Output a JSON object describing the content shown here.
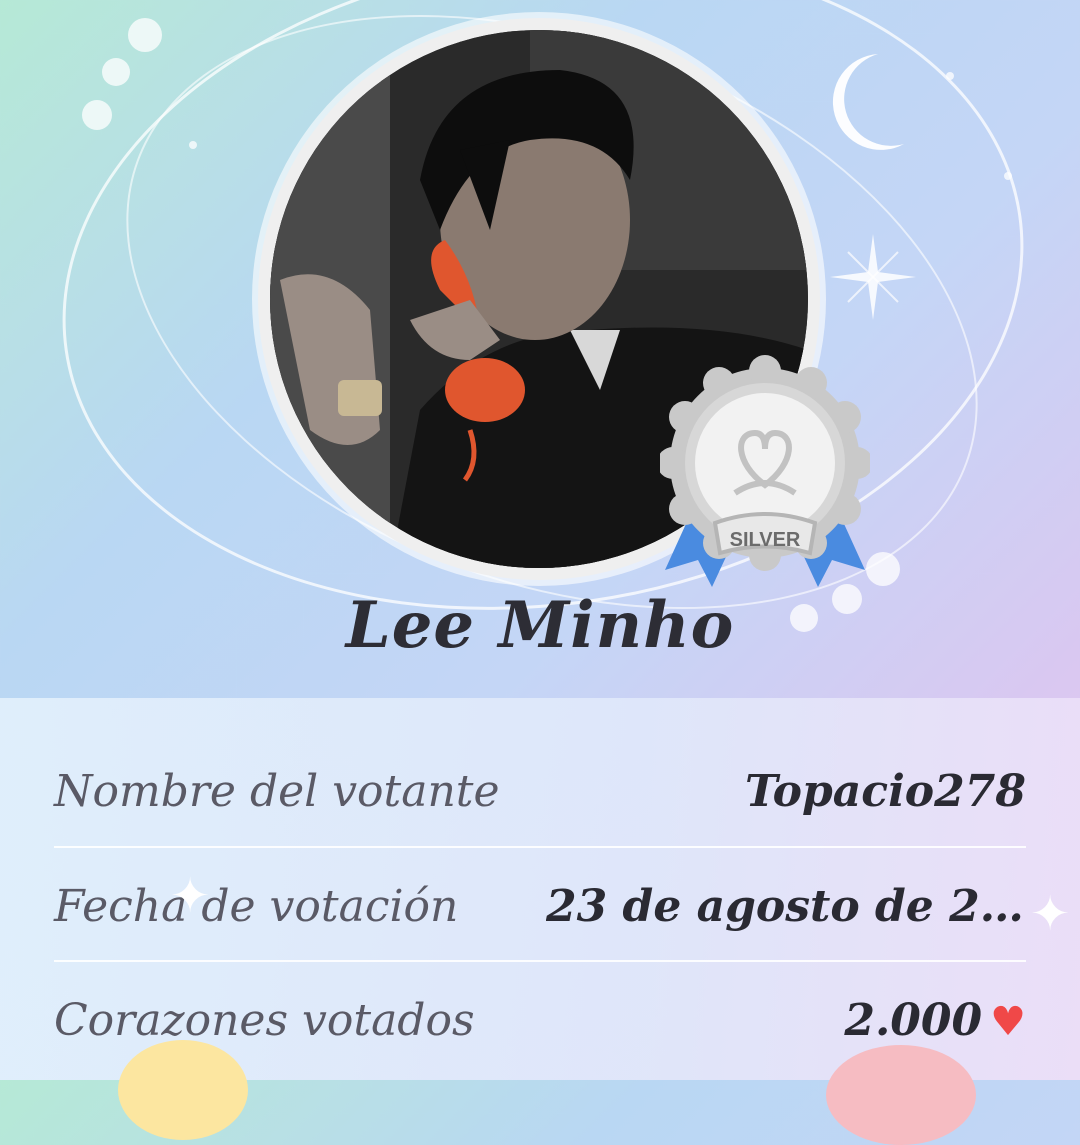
{
  "profile": {
    "name": "Lee Minho",
    "badge_label": "SILVER"
  },
  "details": {
    "rows": [
      {
        "label": "Nombre del votante",
        "value": "Topacio278"
      },
      {
        "label": "Fecha de votación",
        "value": "23 de agosto de 202..."
      },
      {
        "label": "Corazones votados",
        "value": "2.000"
      }
    ]
  },
  "icons": {
    "heart": "heart-icon",
    "moon": "moon-icon",
    "sparkle": "sparkle-icon",
    "medal": "silver-medal-icon"
  },
  "colors": {
    "heart": "#f04848",
    "medal_ribbon": "#4a8be0"
  }
}
